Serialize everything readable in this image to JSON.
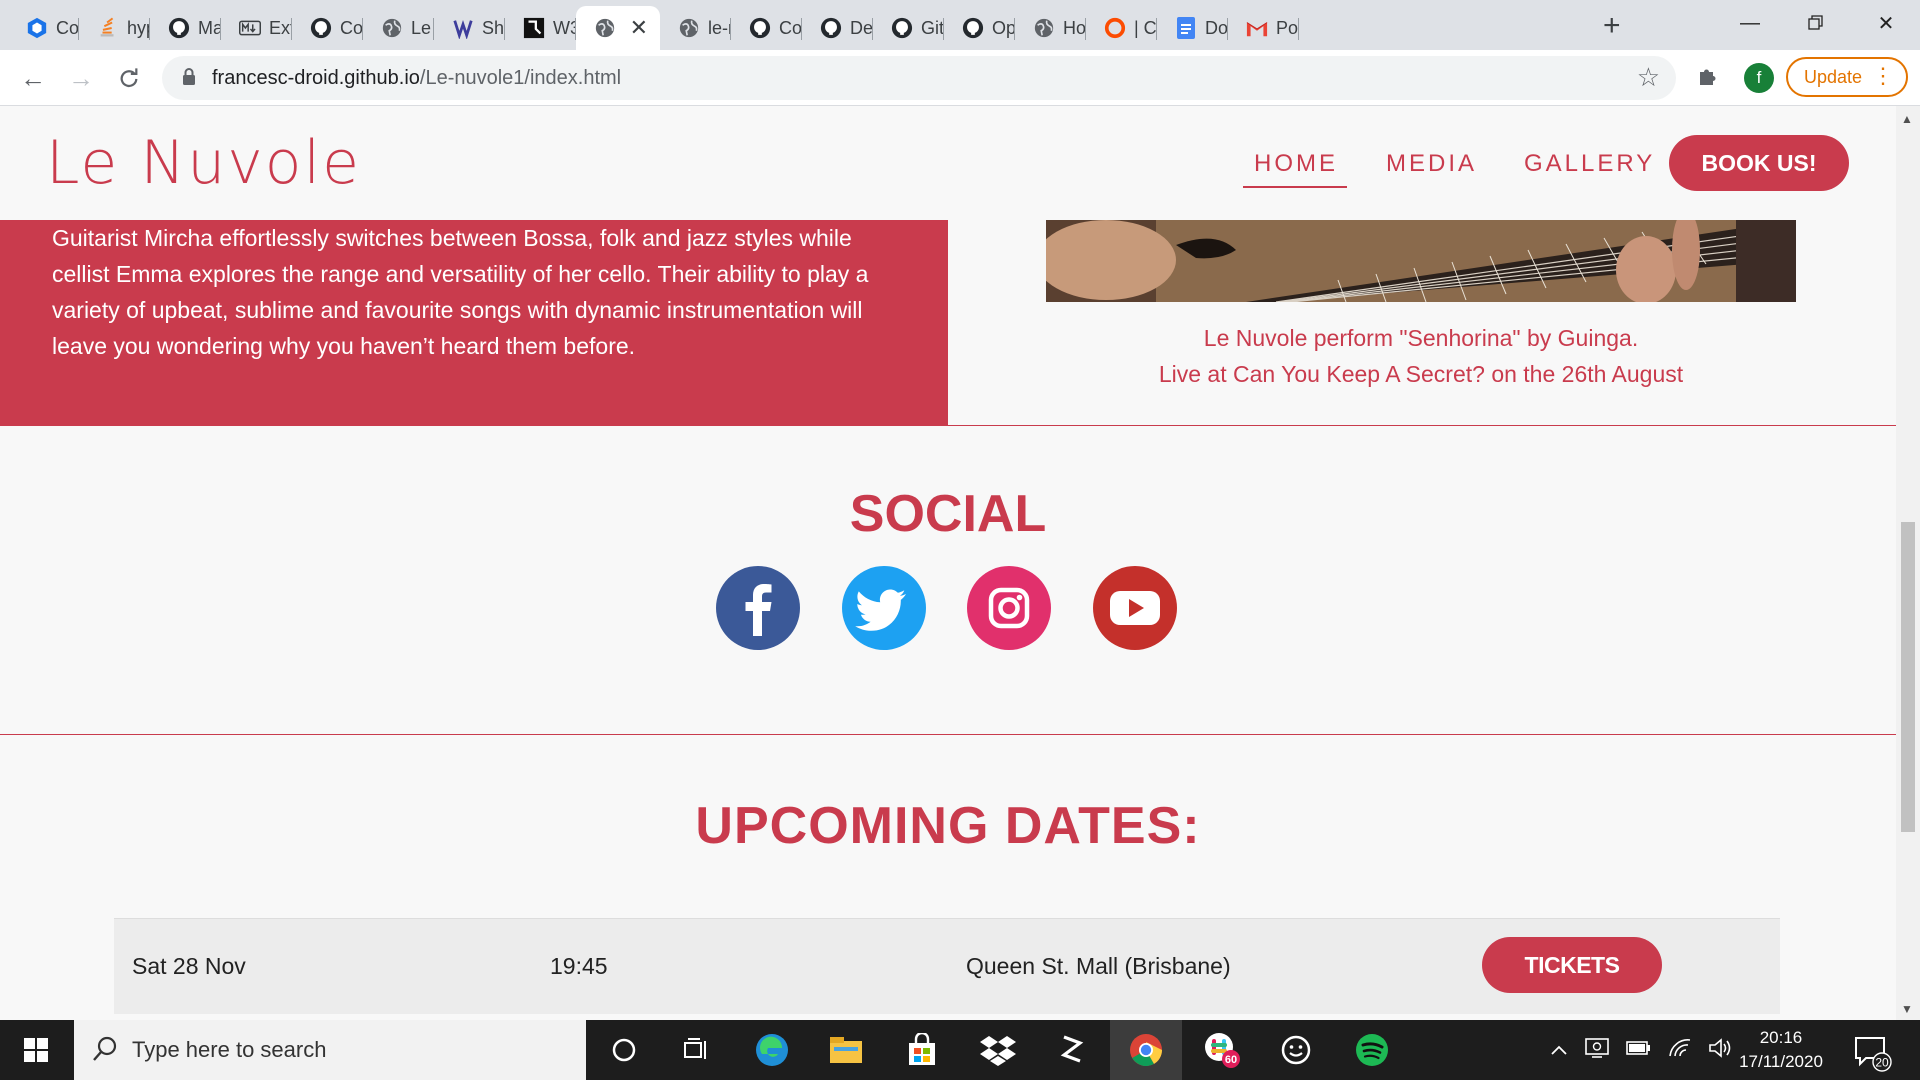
{
  "browser": {
    "tabs": [
      {
        "label": "Coc",
        "icon": "codeanywhere-icon"
      },
      {
        "label": "hyp",
        "icon": "stackoverflow-icon"
      },
      {
        "label": "Ma",
        "icon": "github-icon"
      },
      {
        "label": "Exte",
        "icon": "markdown-icon"
      },
      {
        "label": "Coc",
        "icon": "github-icon"
      },
      {
        "label": "Le I",
        "icon": "globe-icon"
      },
      {
        "label": "Shc",
        "icon": "site-icon"
      },
      {
        "label": "W3",
        "icon": "w3c-icon"
      },
      {
        "label": "",
        "icon": "globe-icon"
      },
      {
        "label": "le-r",
        "icon": "globe-icon"
      },
      {
        "label": "Cor",
        "icon": "github-icon"
      },
      {
        "label": "Dep",
        "icon": "github-icon"
      },
      {
        "label": "Gitl",
        "icon": "github-icon"
      },
      {
        "label": "Opt",
        "icon": "github-icon"
      },
      {
        "label": "Hov",
        "icon": "globe-icon"
      },
      {
        "label": "| Cc",
        "icon": "ring-icon"
      },
      {
        "label": "Doc",
        "icon": "docs-icon"
      },
      {
        "label": "Pos",
        "icon": "gmail-icon"
      }
    ],
    "active_tab_index": 8,
    "address": {
      "host": "francesc-droid.github.io",
      "path": "/Le-nuvole1/index.html"
    },
    "profile_initial": "f",
    "update_label": "Update"
  },
  "site": {
    "logo": "Le Nuvole",
    "nav": {
      "home": "HOME",
      "media": "MEDIA",
      "gallery": "GALLERY",
      "book": "BOOK US!"
    },
    "about_text": "Guitarist Mircha effortlessly switches between Bossa, folk and jazz styles while cellist Emma explores the range and versatility of her cello. Their ability to play a variety of upbeat, sublime and favourite songs with dynamic instrumentation will leave you wondering why you haven’t heard them before.",
    "caption_line1": "Le Nuvole perform \"Senhorina\" by Guinga.",
    "caption_line2": "Live at Can You Keep A Secret? on the 26th August",
    "social_title": "SOCIAL",
    "social_links": [
      {
        "name": "facebook",
        "color": "#3b5998"
      },
      {
        "name": "twitter",
        "color": "#1da1f2"
      },
      {
        "name": "instagram",
        "color": "#e1306c"
      },
      {
        "name": "youtube",
        "color": "#c4302b"
      }
    ],
    "upcoming_title": "UPCOMING DATES:",
    "dates": [
      {
        "date": "Sat 28 Nov",
        "time": "19:45",
        "venue": "Queen St. Mall (Brisbane)",
        "button": "TICKETS"
      }
    ],
    "accent": "#c93b4d"
  },
  "taskbar": {
    "search_placeholder": "Type here to search",
    "time": "20:16",
    "date": "17/11/2020",
    "slack_badge": "60",
    "notification_count": "20"
  }
}
